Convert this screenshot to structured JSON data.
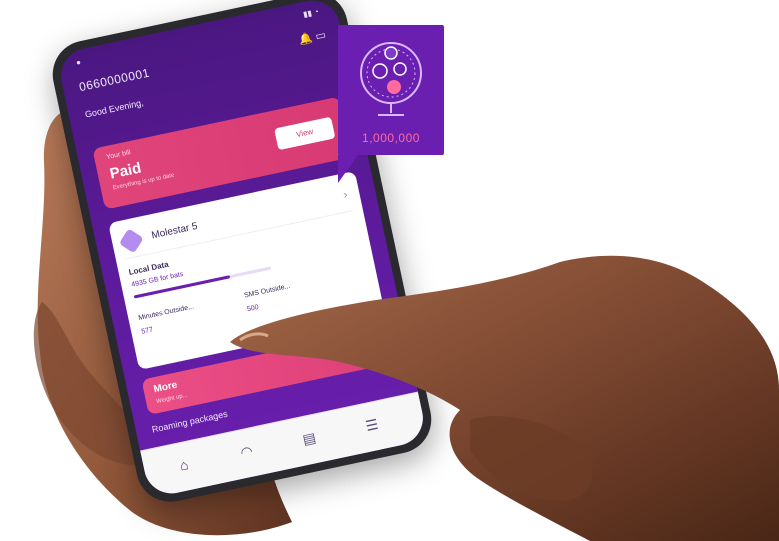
{
  "phone": {
    "number": "0660000001",
    "greeting": "Good Evening,",
    "bill": {
      "kicker": "Your bill",
      "status": "Paid",
      "sub": "Everything is up to date",
      "button": "View"
    },
    "plan": {
      "name": "Molestar 5",
      "local_data_label": "Local Data",
      "local_data_value": "4935 GB for bats",
      "minutes_label": "Minutes Outside...",
      "minutes_value": "577",
      "sms_label": "SMS Outside...",
      "sms_value": "500"
    },
    "more": {
      "title": "More",
      "sub": "Weight up..."
    },
    "roaming_title": "Roaming packages",
    "tabs": [
      "home",
      "lottery",
      "bill",
      "menu"
    ]
  },
  "lottery_card": {
    "amount": "1,000,000"
  }
}
